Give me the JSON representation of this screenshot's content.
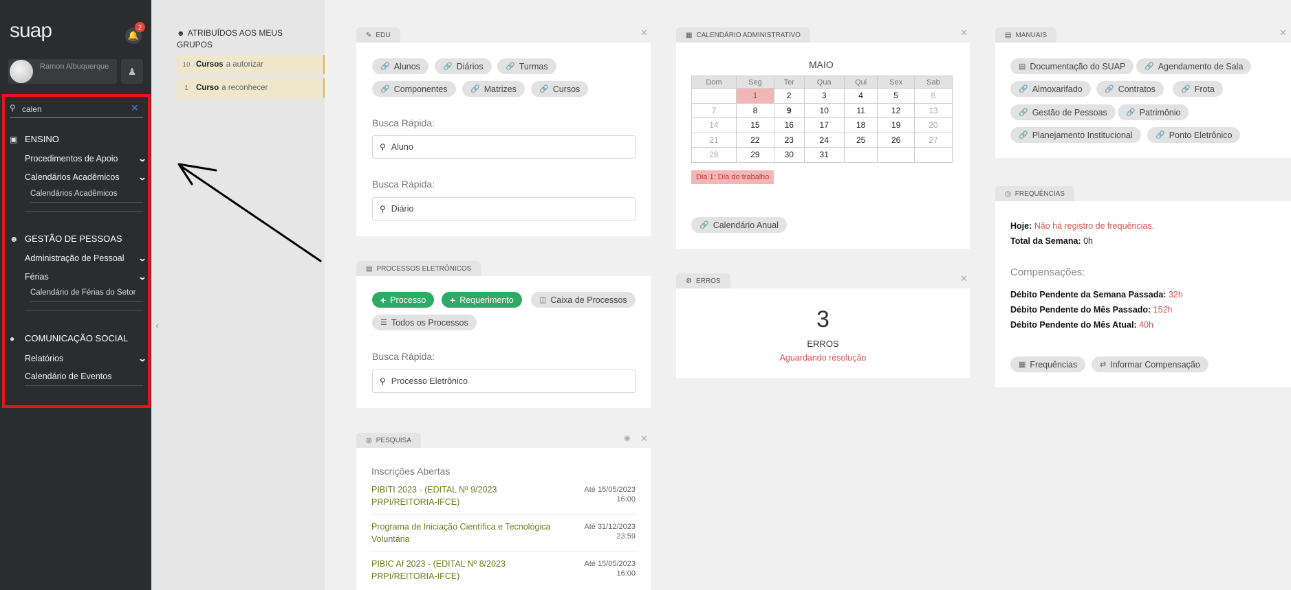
{
  "app": {
    "logo": "suap",
    "notification_count": "2",
    "user_name": "Ramon Albuquerque"
  },
  "sidebar": {
    "search_value": "calen",
    "sections": {
      "ensino": "ENSINO",
      "gestao": "GESTÃO DE PESSOAS",
      "comunicacao": "COMUNICAÇÃO SOCIAL"
    },
    "items": {
      "procedimentos": "Procedimentos de Apoio",
      "calendarios_academicos": "Calendários Acadêmicos",
      "calendarios_academicos_sub": "Calendários Acadêmicos",
      "administracao": "Administração de Pessoal",
      "ferias": "Férias",
      "calendario_ferias": "Calendário de Férias do Setor",
      "relatorios": "Relatórios",
      "calendario_eventos": "Calendário de Eventos"
    }
  },
  "groups": {
    "title": "ATRIBUÍDOS AOS MEUS GRUPOS",
    "rows": [
      {
        "num": "10",
        "bold": "Cursos",
        "rest": "a autorizar"
      },
      {
        "num": "1",
        "bold": "Curso",
        "rest": "a reconhecer"
      }
    ]
  },
  "edu": {
    "tab": "EDU",
    "links": [
      "Alunos",
      "Diários",
      "Turmas",
      "Componentes",
      "Matrizes",
      "Cursos"
    ],
    "quick1_label": "Busca Rápida:",
    "quick1_placeholder": "Aluno",
    "quick2_label": "Busca Rápida:",
    "quick2_placeholder": "Diário"
  },
  "processos": {
    "tab": "PROCESSOS ELETRÔNICOS",
    "btn_processo": "Processo",
    "btn_requerimento": "Requerimento",
    "btn_caixa": "Caixa de Processos",
    "btn_todos": "Todos os Processos",
    "quick_label": "Busca Rápida:",
    "quick_placeholder": "Processo Eletrônico"
  },
  "pesquisa": {
    "tab": "PESQUISA",
    "title": "Inscrições Abertas",
    "items": [
      {
        "title": "PIBITI 2023 - (EDITAL Nº 9/2023 PRPI/REITORIA-IFCE)",
        "date": "Até 15/05/2023 16:00"
      },
      {
        "title": "Programa de Iniciação Científica e Tecnológica Voluntária",
        "date": "Até 31/12/2023 23:59"
      },
      {
        "title": "PIBIC Af 2023 - (EDITAL Nº 8/2023 PRPI/REITORIA-IFCE)",
        "date": "Até 15/05/2023 16:00"
      }
    ]
  },
  "calendario": {
    "tab": "CALENDÁRIO ADMINISTRATIVO",
    "month": "MAIO",
    "weekdays": [
      "Dom",
      "Seg",
      "Ter",
      "Qua",
      "Qui",
      "Sex",
      "Sab"
    ],
    "weeks": [
      [
        "",
        "1",
        "2",
        "3",
        "4",
        "5",
        "6"
      ],
      [
        "7",
        "8",
        "9",
        "10",
        "11",
        "12",
        "13"
      ],
      [
        "14",
        "15",
        "16",
        "17",
        "18",
        "19",
        "20"
      ],
      [
        "21",
        "22",
        "23",
        "24",
        "25",
        "26",
        "27"
      ],
      [
        "28",
        "29",
        "30",
        "31",
        "",
        "",
        ""
      ]
    ],
    "holiday_day": "1",
    "today_day": "9",
    "holiday_label": "Dia 1: Dia do trabalho",
    "annual_link": "Calendário Anual"
  },
  "erros": {
    "tab": "ERROS",
    "count": "3",
    "label": "ERROS",
    "status": "Aguardando resolução"
  },
  "manuais": {
    "tab": "MANUAIS",
    "links": [
      "Documentação do SUAP",
      "Agendamento de Sala",
      "Almoxarifado",
      "Contratos",
      "Frota",
      "Gestão de Pessoas",
      "Patrimônio",
      "Planejamento Institucional",
      "Ponto Eletrônico"
    ]
  },
  "frequencias": {
    "tab": "FREQUÊNCIAS",
    "hoje_label": "Hoje:",
    "hoje_value": "Não há registro de frequências.",
    "semana_label": "Total da Semana:",
    "semana_value": "0h",
    "comp_title": "Compensações:",
    "deb_semana_label": "Débito Pendente da Semana Passada:",
    "deb_semana_value": "32h",
    "deb_mes_passado_label": "Débito Pendente do Mês Passado:",
    "deb_mes_passado_value": "152h",
    "deb_mes_atual_label": "Débito Pendente do Mês Atual:",
    "deb_mes_atual_value": "40h",
    "btn_freq": "Frequências",
    "btn_comp": "Informar Compensação"
  },
  "colors": {
    "sidebar_bg": "#2b2c2e",
    "highlight_red": "#e8131b",
    "green_button": "#2dab66",
    "holiday_pink": "#f3b6b6",
    "alert_red": "#d9534f"
  }
}
